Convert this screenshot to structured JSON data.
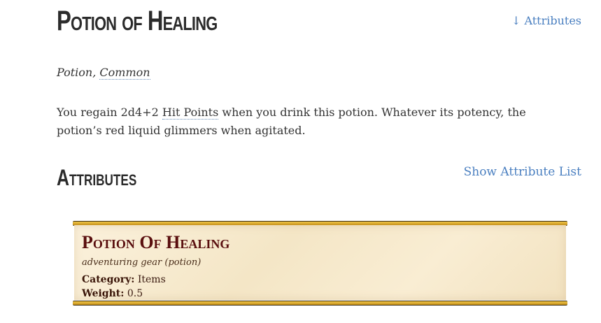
{
  "item": {
    "title": "Potion of Healing",
    "subtype_prefix": "Potion, ",
    "rarity": "Common",
    "description": {
      "before": "You regain 2d4+2 ",
      "link": "Hit Points",
      "after": " when you drink this potion. Whatever its potency, the potion’s red liquid glimmers when agitated."
    }
  },
  "links": {
    "jump_attributes": "↓ Attributes",
    "show_attribute_list": "Show Attribute List"
  },
  "attributes": {
    "heading": "Attributes"
  },
  "statblock": {
    "title": "Potion Of Healing",
    "subtitle": "adventuring gear (potion)",
    "properties": [
      {
        "key": "Category:",
        "value": " Items"
      },
      {
        "key": "Weight:",
        "value": " 0.5"
      }
    ]
  },
  "colors": {
    "link": "#4a7fc0",
    "statblock_title": "#5a0f0f",
    "bar_gold": "#e0ad2e",
    "parchment": "#f7ead0"
  }
}
